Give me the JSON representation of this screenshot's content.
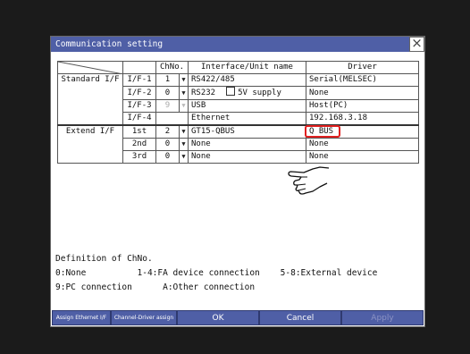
{
  "window": {
    "title": "Communication setting",
    "close_glyph": "×"
  },
  "table": {
    "headers": {
      "chno": "ChNo.",
      "interface": "Interface/Unit name",
      "driver": "Driver"
    },
    "groups": {
      "standard": "Standard I/F",
      "extend": "Extend I/F"
    },
    "rows": [
      {
        "if": "I/F-1",
        "ch": "1",
        "iface": "RS422/485",
        "driver": "Serial(MELSEC)"
      },
      {
        "if": "I/F-2",
        "ch": "0",
        "iface": "RS232",
        "extra": "5V supply",
        "driver": "None"
      },
      {
        "if": "I/F-3",
        "ch": "9",
        "iface": "USB",
        "driver": "Host(PC)"
      },
      {
        "if": "I/F-4",
        "ch": "",
        "iface": "Ethernet",
        "driver": "192.168.3.18"
      },
      {
        "if": "1st",
        "ch": "2",
        "iface": "GT15-QBUS",
        "driver": "Q BUS"
      },
      {
        "if": "2nd",
        "ch": "0",
        "iface": "None",
        "driver": "None"
      },
      {
        "if": "3rd",
        "ch": "0",
        "iface": "None",
        "driver": "None"
      }
    ],
    "dropdown_glyph": "▼"
  },
  "definition": {
    "title": "Definition of ChNo.",
    "line1": "0:None          1-4:FA device connection    5-8:External device",
    "line2": "9:PC connection      A:Other connection"
  },
  "buttons": {
    "assign_ethernet": "Assign Ethernet I/F",
    "channel_driver": "Channel-Driver assign",
    "ok": "OK",
    "cancel": "Cancel",
    "apply": "Apply"
  },
  "colors": {
    "titlebar": "#4f5fa6",
    "highlight": "#e02020",
    "bezel": "#1b1b1b"
  }
}
